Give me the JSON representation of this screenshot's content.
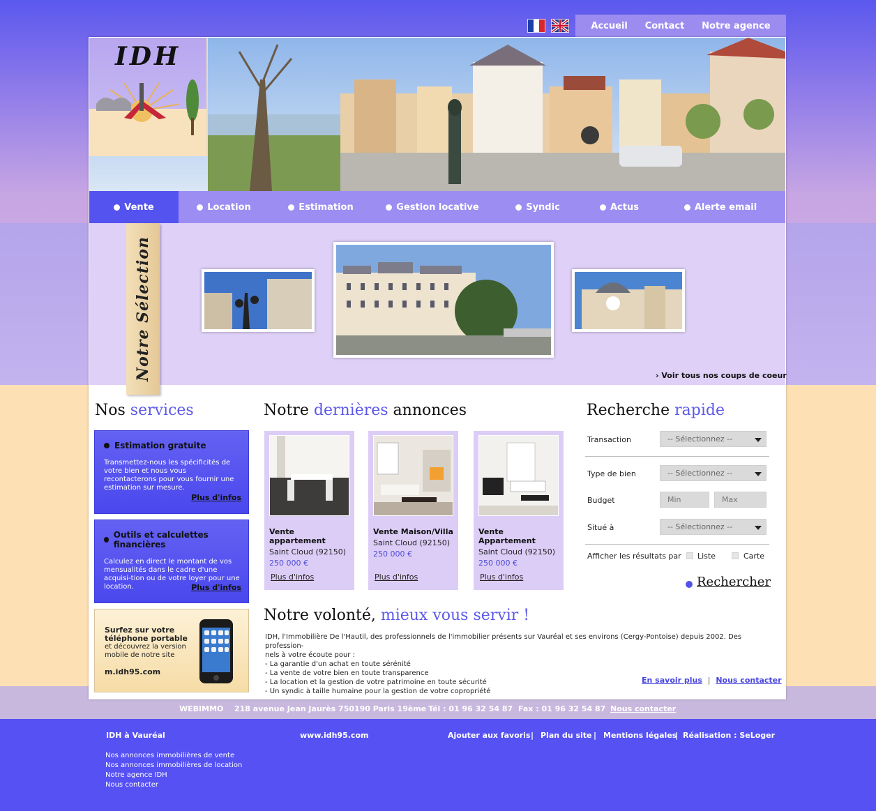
{
  "topnav": {
    "items": [
      "Accueil",
      "Contact",
      "Notre agence"
    ]
  },
  "flags": {
    "fr": "flag-fr-icon",
    "en": "flag-uk-icon"
  },
  "logo": {
    "text": "IDH"
  },
  "mainnav": {
    "active": "Vente",
    "items": [
      "Vente",
      "Location",
      "Estimation",
      "Gestion locative",
      "Syndic",
      "Actus",
      "Alerte email"
    ]
  },
  "selection": {
    "tab_label": "Notre Sélection",
    "see_all": "› Voir tous nos coups de coeur"
  },
  "services": {
    "heading_plain": "Nos",
    "heading_hl": "services",
    "box1": {
      "title": "Estimation gratuite",
      "desc": "Transmettez-nous les spécificités de votre bien et nous vous recontacterons pour vous fournir une estimation sur mesure.",
      "more": "Plus d'infos"
    },
    "box2": {
      "title": "Outils et calculettes financières",
      "desc": "Calculez en direct le montant de vos mensualités dans le cadre d'une acquisi-tion ou de votre loyer pour une location.",
      "more": "Plus d'infos"
    },
    "mobile": {
      "line1": "Surfez sur votre",
      "line2": "téléphone portable",
      "line3": "et découvrez la version",
      "line4": "mobile de notre site",
      "url": "m.idh95.com"
    }
  },
  "annonces": {
    "heading_plain1": "Notre",
    "heading_hl": "dernières",
    "heading_plain2": "annonces",
    "cards": [
      {
        "title": "Vente appartement",
        "city": "Saint Cloud  (92150)",
        "price": "250 000 €",
        "more": "Plus d'infos"
      },
      {
        "title": "Vente Maison/Villa",
        "city": "Saint Cloud  (92150)",
        "price": "250 000 €",
        "more": "Plus d'infos"
      },
      {
        "title": "Vente Appartement",
        "city": "Saint Cloud  (92150)",
        "price": "250 000 €",
        "more": "Plus d'infos"
      }
    ]
  },
  "search": {
    "heading_plain": "Recherche",
    "heading_hl": "rapide",
    "transaction_label": "Transaction",
    "type_label": "Type de bien",
    "budget_label": "Budget",
    "situe_label": "Situé à",
    "select_default": "-- Sélectionnez --",
    "min_placeholder": "Min",
    "max_placeholder": "Max",
    "display_label": "Afficher les résultats par",
    "opt_list": "Liste",
    "opt_map": "Carte",
    "button": "Rechercher"
  },
  "volonte": {
    "heading_plain": "Notre volonté,",
    "heading_hl": "mieux vous servir !",
    "lines": [
      "IDH, l'Immobilière De l'Hautil, des professionnels de l'immobilier présents sur Vauréal et ses environs (Cergy-Pontoise) depuis 2002. Des profession-",
      "nels à votre écoute pour :",
      "- La garantie d'un achat en toute sérénité",
      "- La vente de votre bien en toute transparence",
      "- La location et la gestion de votre patrimoine en toute sécurité",
      "- Un syndic à taille humaine pour la gestion de votre copropriété"
    ],
    "link_more": "En savoir plus",
    "link_sep": "|",
    "link_contact": "Nous contacter"
  },
  "addressbar": {
    "brand": "WEBIMMO",
    "address": "218 avenue Jean Jaurès 750190 Paris 19ème",
    "tel": "Tél : 01 96 32 54 87",
    "fax": "Fax : 01 96 32 54 87",
    "contact": "Nous contacter"
  },
  "footer": {
    "title": "IDH à Vauréal",
    "site": "www.idh95.com",
    "links_right": [
      "Ajouter aux favoris",
      "Plan du site",
      "Mentions légales",
      "Réalisation : SeLoger"
    ],
    "sep": "|",
    "links_left": [
      "Nos annonces immobilières de vente",
      "Nos annonces immobilières de location",
      "Notre agence IDH",
      "Nous contacter"
    ]
  }
}
